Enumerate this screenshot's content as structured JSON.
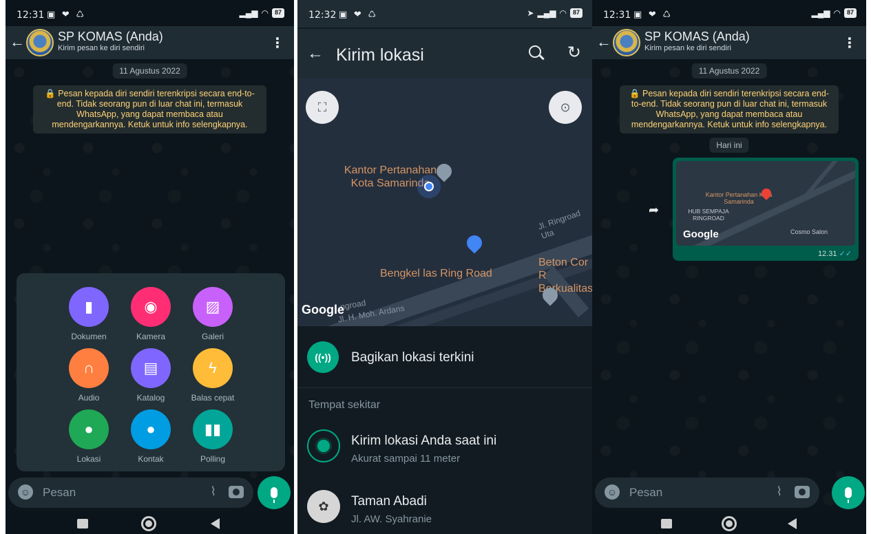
{
  "colors": {
    "accent": "#00a884",
    "header": "#1f2c34",
    "bg": "#0b141a",
    "notice_text": "#ffd279",
    "outgoing_bubble": "#005c4b"
  },
  "status": {
    "time_left": "12:31",
    "time_mid": "12:32",
    "time_right": "12:31",
    "battery": "87"
  },
  "chat": {
    "name": "SP KOMAS (Anda)",
    "subtitle": "Kirim pesan ke diri sendiri",
    "date_chip": "11 Agustus 2022",
    "encryption_notice": "🔒 Pesan kepada diri sendiri terenkripsi secara end-to-end. Tidak seorang pun di luar chat ini, termasuk WhatsApp, yang dapat membaca atau mendengarkannya. Ketuk untuk info selengkapnya.",
    "today_chip": "Hari ini",
    "input_placeholder": "Pesan"
  },
  "attach_menu": {
    "items": [
      {
        "label": "Dokumen",
        "icon": "document-icon",
        "color": "#7f66ff"
      },
      {
        "label": "Kamera",
        "icon": "camera-icon",
        "color": "#ff2e74"
      },
      {
        "label": "Galeri",
        "icon": "gallery-icon",
        "color": "#c861fa"
      },
      {
        "label": "Audio",
        "icon": "headphones-icon",
        "color": "#ff7f40"
      },
      {
        "label": "Katalog",
        "icon": "store-icon",
        "color": "#7f66ff"
      },
      {
        "label": "Balas cepat",
        "icon": "lightning-icon",
        "color": "#ffbc38"
      },
      {
        "label": "Lokasi",
        "icon": "location-icon",
        "color": "#1fa855"
      },
      {
        "label": "Kontak",
        "icon": "contact-icon",
        "color": "#009de2"
      },
      {
        "label": "Polling",
        "icon": "poll-icon",
        "color": "#02a698"
      }
    ]
  },
  "location_screen": {
    "title": "Kirim lokasi",
    "map_labels": {
      "kantor": "Kantor Pertanahan Kota Samarinda",
      "bengkel": "Bengkel las Ring Road",
      "beton": "Beton Cor R Berkualitas",
      "road1": "Jl. Ringroad Uta",
      "road2": "Jl. H. Moh. Ardans",
      "road3": "ngroad",
      "google": "Google"
    },
    "share_live": "Bagikan lokasi terkini",
    "nearby_header": "Tempat sekitar",
    "current": {
      "title": "Kirim lokasi Anda saat ini",
      "subtitle": "Akurat sampai 11 meter"
    },
    "place": {
      "title": "Taman Abadi",
      "subtitle": "Jl. AW. Syahranie"
    }
  },
  "sent_message": {
    "map_labels": {
      "kantor": "Kantor Pertanahan Kota Samarinda",
      "hub": "HUB SEMPAJA RINGROAD",
      "cosmo": "Cosmo Salon",
      "google": "Google"
    },
    "time": "12.31"
  }
}
